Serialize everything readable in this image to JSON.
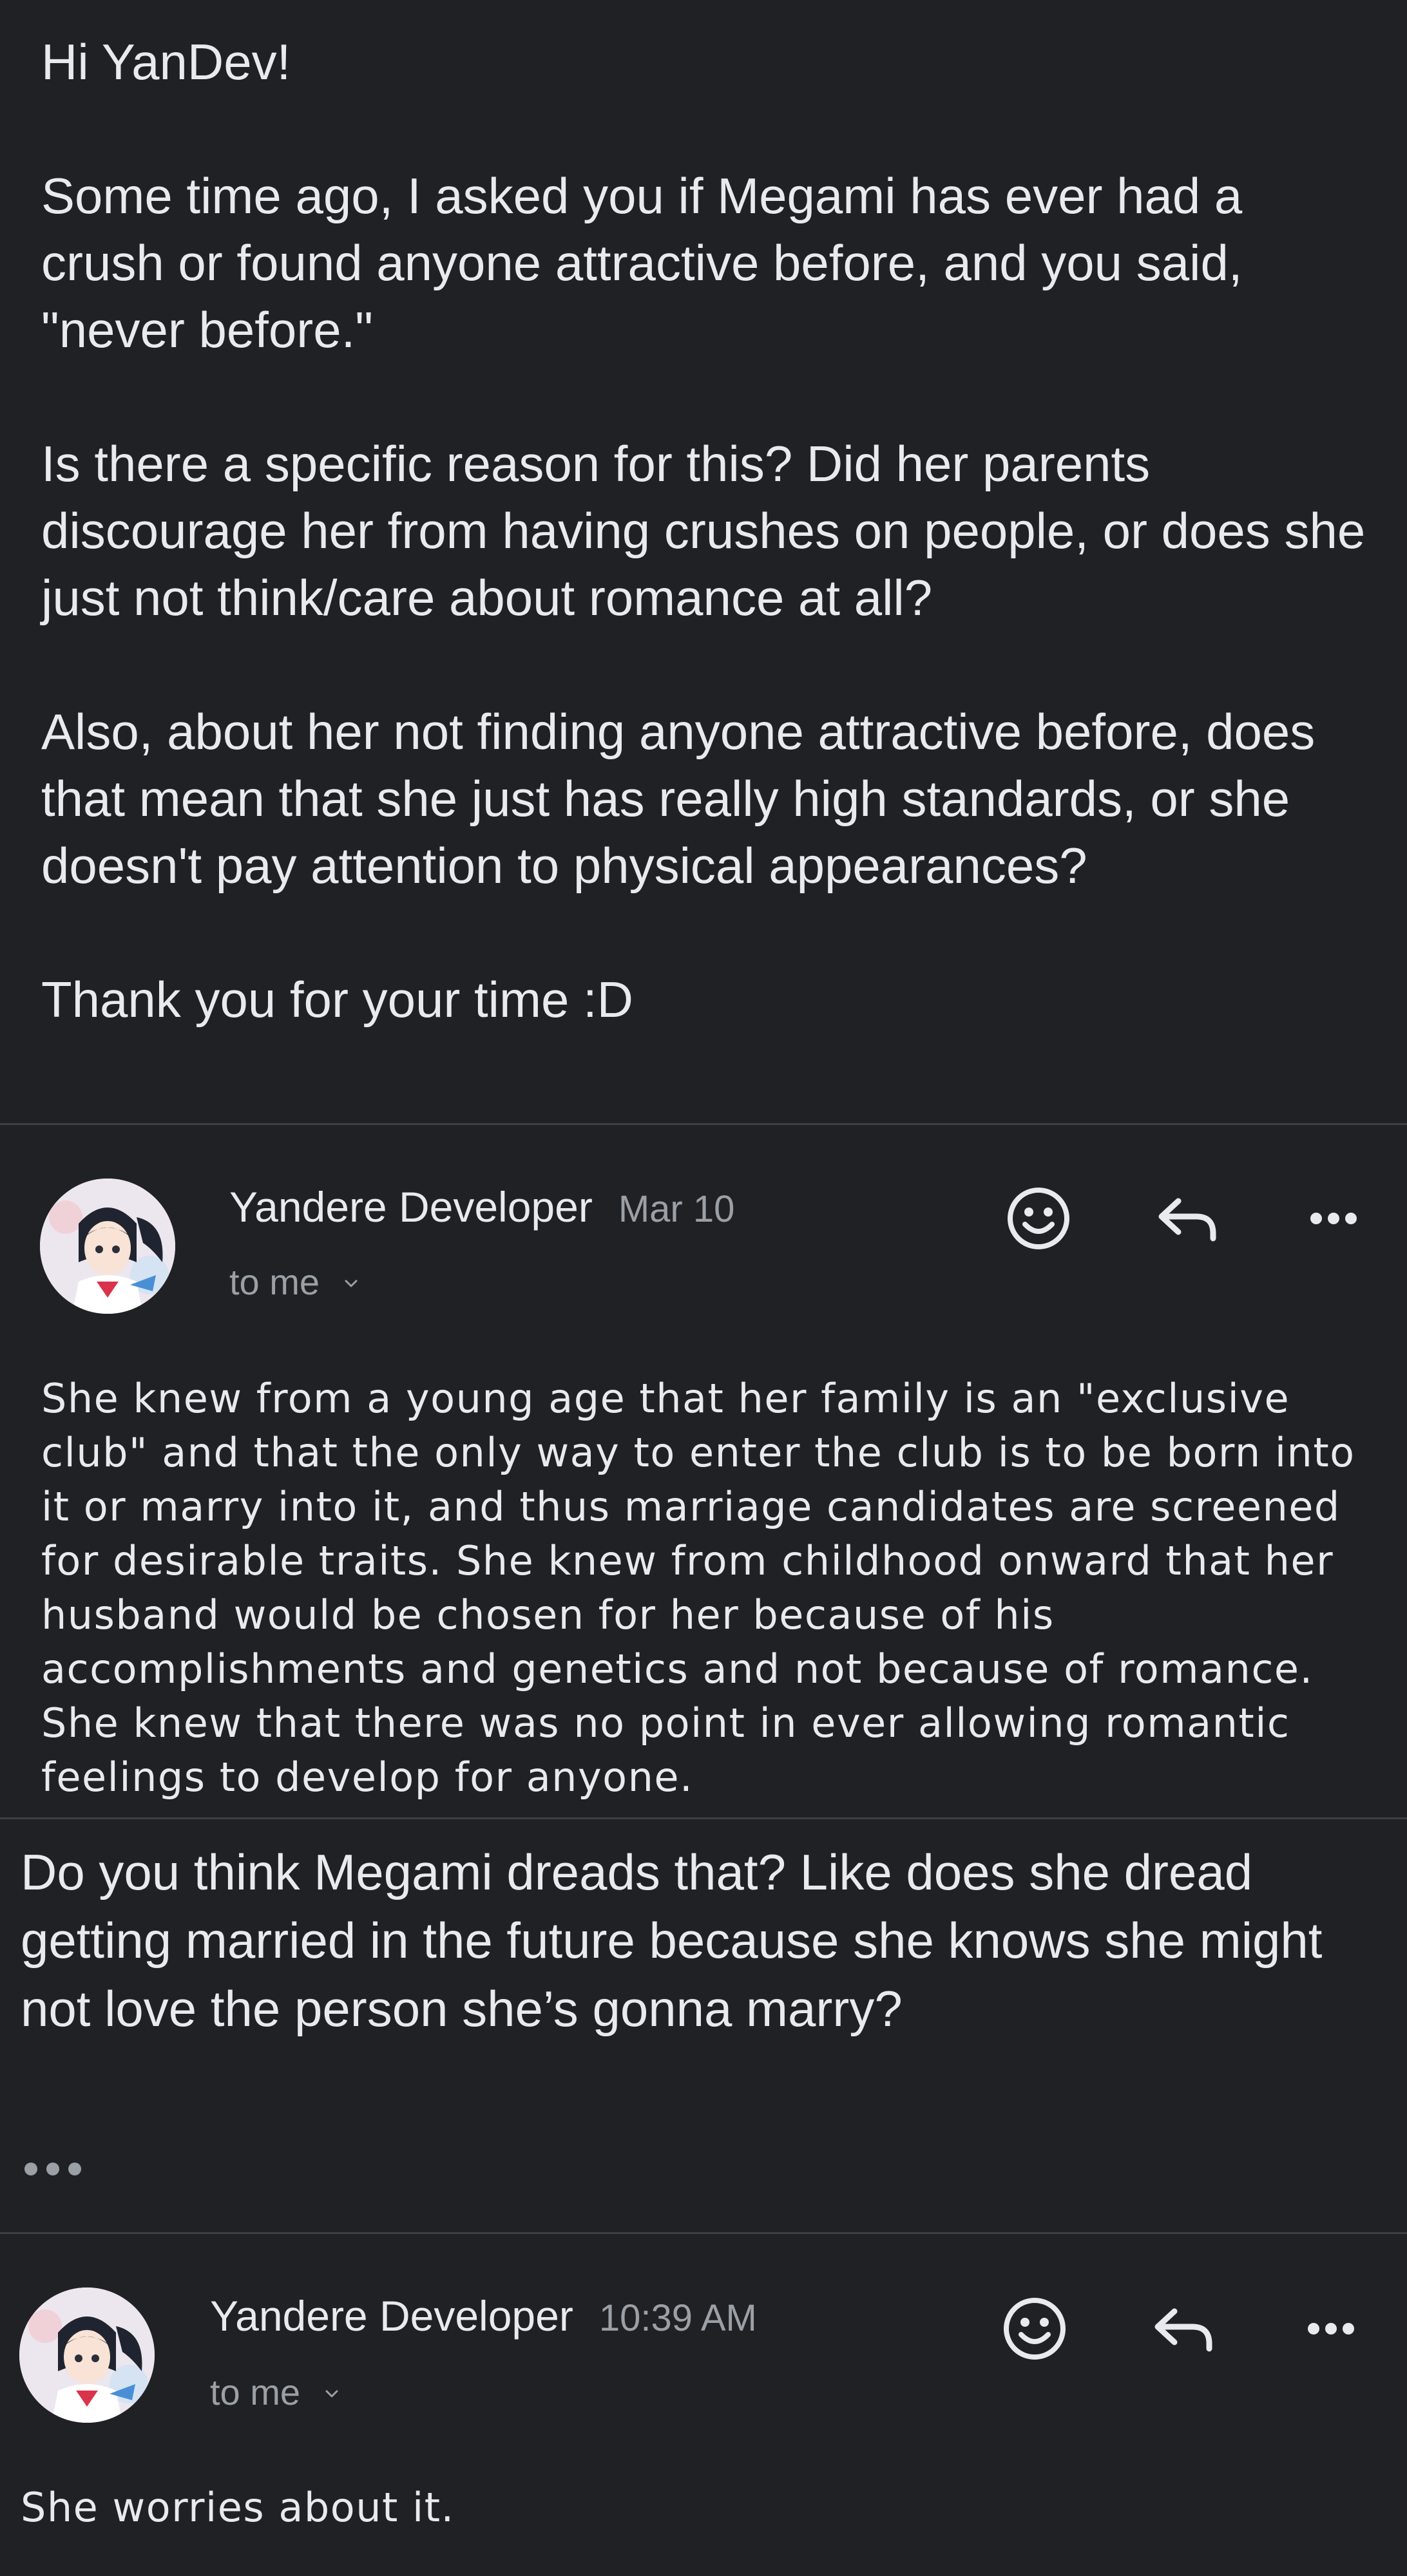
{
  "thread": {
    "question": {
      "paragraphs": [
        "Hi YanDev!",
        "Some time ago, I asked you if Megami has ever had a crush or found anyone attractive before, and you said, \"never before.\"",
        "Is there a specific reason for this? Did her parents discourage her from having crushes on people, or does she just not think/care about romance at all?",
        "Also, about her not finding anyone attractive before, does that mean that she just has really high standards, or she doesn't pay attention to physical appearances?",
        "Thank you for your time :D"
      ]
    },
    "reply1": {
      "sender": "Yandere Developer",
      "date": "Mar 10",
      "recipient": "to me",
      "body": "She knew from a young age that her family is an \"exclusive club\" and that the only way to enter the club is to be born into it or marry into it, and thus marriage candidates are screened for desirable traits. She knew from childhood onward that her husband would be chosen for her because of his accomplishments and genetics and not because of romance. She knew that there was no point in ever allowing romantic feelings to develop for anyone."
    },
    "followup": {
      "body": "Do you think Megami dreads that? Like does she dread getting married in the future because she knows she might not love the person she’s gonna marry?"
    },
    "reply2": {
      "sender": "Yandere Developer",
      "date": "10:39 AM",
      "recipient": "to me",
      "body": "She worries about it."
    }
  },
  "icons": {
    "emoji": "emoji-smile-icon",
    "reply": "reply-arrow-icon",
    "more": "more-horizontal-icon",
    "chevron": "chevron-down-icon",
    "show_trimmed": "show-trimmed-content-icon"
  },
  "colors": {
    "background": "#202124",
    "text_primary": "#e8eaed",
    "text_secondary": "#9aa0a6",
    "divider": "#3c4043"
  }
}
